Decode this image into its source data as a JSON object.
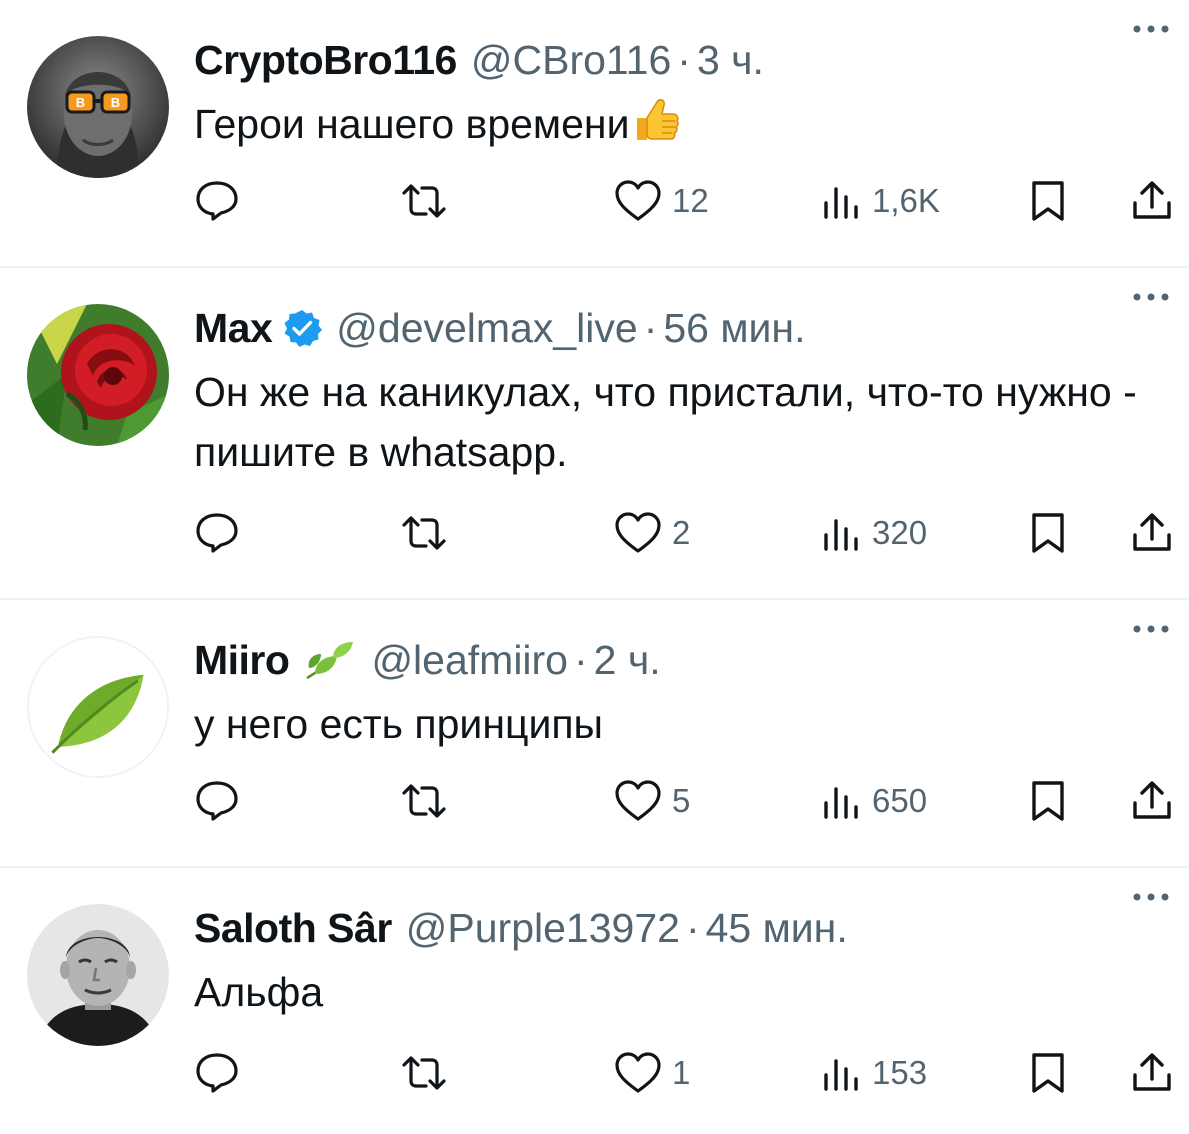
{
  "tweets": [
    {
      "name": "CryptoBro116",
      "handle": "@CBro116",
      "separator": "·",
      "time": "3 ч.",
      "text": "Герои нашего времени",
      "text_emoji": "thumbs-up-icon",
      "likes": "12",
      "views": "1,6K",
      "avatar": "crypto-bro-avatar"
    },
    {
      "name": "Max",
      "badge": "verified-badge-icon",
      "handle": "@develmax_live",
      "separator": "·",
      "time": "56 мин.",
      "text": "Он же на каникулах, что пристали, что-то нужно - пишите в whatsapp.",
      "likes": "2",
      "views": "320",
      "avatar": "red-rose-avatar"
    },
    {
      "name": "Miiro",
      "badge": "leaf-badge-icon",
      "handle": "@leafmiiro",
      "separator": "·",
      "time": "2 ч.",
      "text": "у него есть принципы",
      "likes": "5",
      "views": "650",
      "avatar": "green-leaf-avatar"
    },
    {
      "name": "Saloth Sâr",
      "handle": "@Purple13972",
      "separator": "·",
      "time": "45 мин.",
      "text": "Альфа",
      "likes": "1",
      "views": "153",
      "avatar": "portrait-avatar"
    }
  ],
  "colors": {
    "text_primary": "#0f1419",
    "text_secondary": "#536471",
    "divider": "#eff3f4",
    "verified": "#1d9bf0"
  }
}
